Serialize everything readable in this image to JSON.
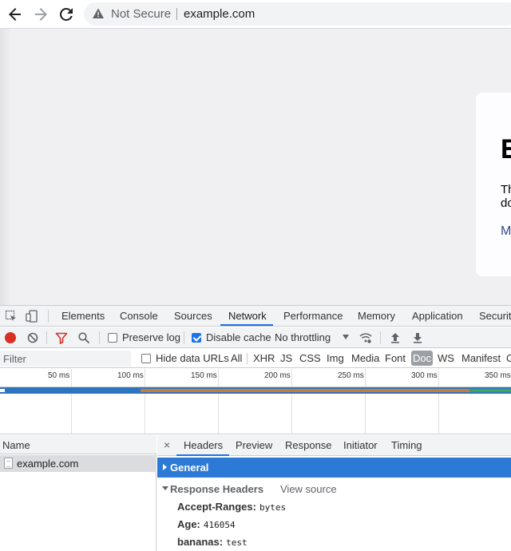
{
  "browser": {
    "security_label": "Not Secure",
    "url": "example.com"
  },
  "page": {
    "heading_partial": "E",
    "paragraph_partial": "Th\ndo",
    "link_partial": "M"
  },
  "devtools": {
    "tabs": [
      "Elements",
      "Console",
      "Sources",
      "Network",
      "Performance",
      "Memory",
      "Application",
      "Security"
    ],
    "active_tab": "Network",
    "network_toolbar": {
      "preserve_log_label": "Preserve log",
      "preserve_log_checked": false,
      "disable_cache_label": "Disable cache",
      "disable_cache_checked": true,
      "throttling": "No throttling"
    },
    "filter": {
      "placeholder": "Filter",
      "hide_data_urls_label": "Hide data URLs",
      "types": [
        "All",
        "XHR",
        "JS",
        "CSS",
        "Img",
        "Media",
        "Font",
        "Doc",
        "WS",
        "Manifest",
        "O"
      ],
      "selected_type": "Doc"
    },
    "timeline": {
      "ticks": [
        "50 ms",
        "100 ms",
        "150 ms",
        "200 ms",
        "250 ms",
        "300 ms",
        "350 ms"
      ]
    },
    "requests": {
      "column_header": "Name",
      "rows": [
        {
          "name": "example.com"
        }
      ]
    },
    "detail": {
      "close_symbol": "×",
      "tabs": [
        "Headers",
        "Preview",
        "Response",
        "Initiator",
        "Timing"
      ],
      "active_tab": "Headers",
      "general_label": "General",
      "response_headers_label": "Response Headers",
      "view_source_label": "View source",
      "headers": [
        {
          "key": "Accept-Ranges:",
          "value": "bytes"
        },
        {
          "key": "Age:",
          "value": "416054"
        },
        {
          "key": "bananas:",
          "value": "test"
        }
      ]
    }
  },
  "colors": {
    "accent": "#1a73e8",
    "record": "#d93025",
    "selected_row": "#2d7ad6"
  }
}
